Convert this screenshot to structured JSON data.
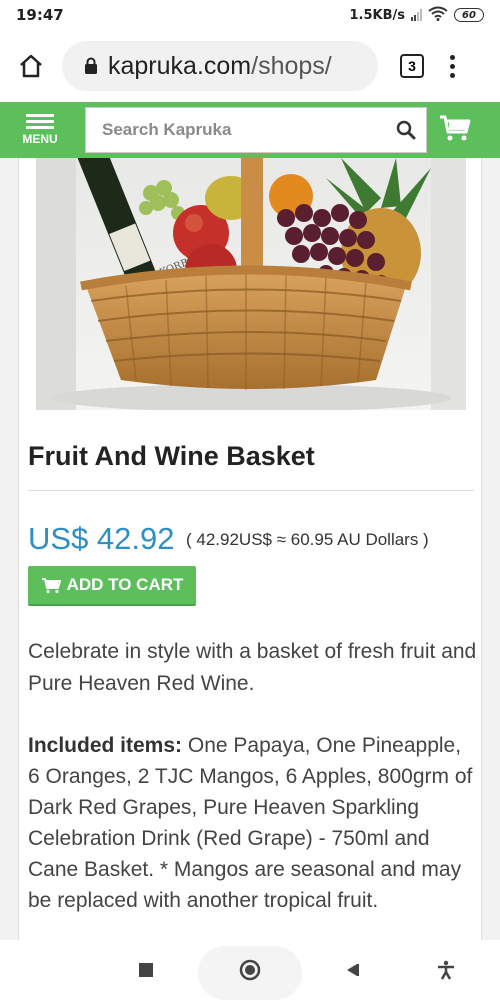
{
  "status_bar": {
    "time": "19:47",
    "network_speed": "1.5KB/s",
    "battery": "60",
    "icons": [
      "signal-icon",
      "wifi-icon",
      "battery-icon"
    ]
  },
  "browser": {
    "url_host": "kapruka.com",
    "url_path": "/shops/",
    "tab_count": "3",
    "icons": [
      "home-icon",
      "lock-icon",
      "tabs-icon",
      "more-options-icon"
    ]
  },
  "site_header": {
    "menu_label": "MENU",
    "search_placeholder": "Search Kapruka",
    "icons": [
      "menu-icon",
      "search-icon",
      "cart-icon"
    ]
  },
  "product": {
    "title": "Fruit And Wine Basket",
    "price": "US$ 42.92",
    "price_conversion": "( 42.92US$ ≈ 60.95 AU Dollars )",
    "add_to_cart_label": "ADD TO CART",
    "description": "Celebrate in style with a basket of fresh fruit and Pure Heaven Red Wine.",
    "included_label": "Included items:",
    "included_text": " One Papaya, One Pineapple, 6 Oranges, 2 TJC Mangos, 6 Apples, 800grm of Dark Red Grapes, Pure Heaven Sparkling Celebration Drink (Red Grape) - 750ml and Cane Basket. * Mangos are seasonal and may be replaced with another tropical fruit.",
    "bottle_label": "KORBEL"
  },
  "colors": {
    "brand_green": "#5cbf5c",
    "price_blue": "#2f8ec4"
  },
  "nav_bar": {
    "icons": [
      "recent-apps-icon",
      "home-circle-icon",
      "back-icon",
      "accessibility-icon"
    ]
  }
}
